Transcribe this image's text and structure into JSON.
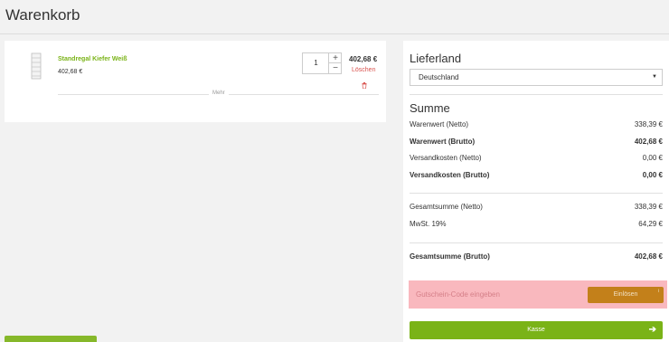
{
  "page": {
    "title": "Warenkorb"
  },
  "cart": {
    "item": {
      "name": "Standregal Kiefer Weiß",
      "unit_price": "402,68 €",
      "quantity": "1",
      "plus": "+",
      "minus": "−",
      "line_total": "402,68 €",
      "delete_label": "Löschen",
      "thumb_icon": "shelf-product-image"
    },
    "more_label": "Mehr"
  },
  "summary": {
    "delivery_heading": "Lieferland",
    "country": "Deutschland",
    "chevron": "▼",
    "sum_heading": "Summe",
    "rows_a": [
      {
        "label": "Warenwert (Netto)",
        "value": "338,39 €",
        "bold": false
      },
      {
        "label": "Warenwert (Brutto)",
        "value": "402,68 €",
        "bold": true
      },
      {
        "label": "Versandkosten (Netto)",
        "value": "0,00 €",
        "bold": false
      },
      {
        "label": "Versandkosten (Brutto)",
        "value": "0,00 €",
        "bold": true
      }
    ],
    "rows_b": [
      {
        "label": "Gesamtsumme (Netto)",
        "value": "338,39 €",
        "bold": false
      },
      {
        "label": "MwSt. 19%",
        "value": "64,29 €",
        "bold": false
      }
    ],
    "total": {
      "label": "Gesamtsumme (Brutto)",
      "value": "402,68 €"
    },
    "voucher": {
      "placeholder": "Gutschein-Code eingeben",
      "button_label": "Einlösen",
      "info_glyph": "i"
    },
    "checkout_label": "Kasse",
    "checkout_arrow": "➔"
  },
  "colors": {
    "accent_green": "#7ab317",
    "voucher_orange": "#c3801a",
    "delete_red": "#d9534f",
    "highlight_pink": "#f9b8be"
  }
}
